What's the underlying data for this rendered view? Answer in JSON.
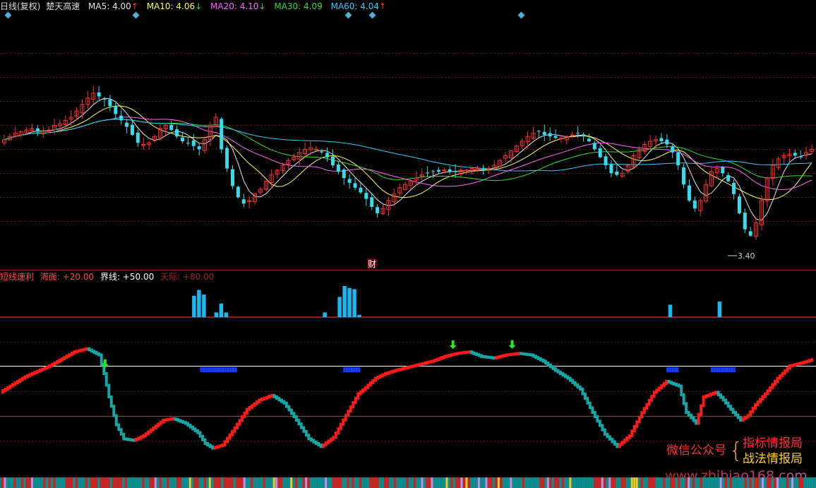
{
  "main_panel": {
    "title": "日线(复权)",
    "indicator_name": "楚天高速",
    "ma_legend": [
      {
        "label": "MA5: 4.00",
        "arrow": "↑",
        "color": "#e8e8e8",
        "arrow_color": "#ff3b3b"
      },
      {
        "label": "MA10: 4.06",
        "arrow": "↓",
        "color": "#ffff55",
        "arrow_color": "#33dd33"
      },
      {
        "label": "MA20: 4.10",
        "arrow": "↓",
        "color": "#ff66ff",
        "arrow_color": "#33dd33"
      },
      {
        "label": "MA30: 4.09",
        "arrow": "",
        "color": "#33dd33",
        "arrow_color": "#33dd33"
      },
      {
        "label": "MA60: 4.04",
        "arrow": "↑",
        "color": "#33ccff",
        "arrow_color": "#ff3b3b"
      }
    ],
    "low_label": "3.40",
    "finance_marker": "财",
    "up_color": "#ff2e2e",
    "down_color": "#33ddee"
  },
  "sub_panel": {
    "legend": [
      {
        "text": "短线速利",
        "color": "#ff4444"
      },
      {
        "text": "海面: +20.00",
        "color": "#ff4444"
      },
      {
        "text": "界线: +50.00",
        "color": "#ffffff"
      },
      {
        "text": "天际: +80.00",
        "color": "#aa2222"
      }
    ],
    "thresholds": {
      "sea": 20,
      "boundary": 50,
      "sky": 80
    }
  },
  "watermark": {
    "label": "微信公众号",
    "line1": "指标情报局",
    "line2": "战法情报局",
    "url": "www.zhibiao168.com"
  },
  "chart_data": [
    {
      "type": "candlestick",
      "title": "楚天高速 日线(复权)",
      "ylim": [
        3.3,
        4.8
      ],
      "price_levels": [
        4.6,
        4.45,
        4.3,
        4.15,
        4.0,
        3.85,
        3.7,
        3.55
      ],
      "series": [
        {
          "name": "MA5",
          "last": 4.0
        },
        {
          "name": "MA10",
          "last": 4.06
        },
        {
          "name": "MA20",
          "last": 4.1
        },
        {
          "name": "MA30",
          "last": 4.09
        },
        {
          "name": "MA60",
          "last": 4.04
        }
      ],
      "closes": [
        4.06,
        4.08,
        4.1,
        4.11,
        4.12,
        4.13,
        4.11,
        4.1,
        4.12,
        4.15,
        4.16,
        4.18,
        4.2,
        4.24,
        4.28,
        4.32,
        4.35,
        4.33,
        4.31,
        4.27,
        4.22,
        4.18,
        4.14,
        4.09,
        4.04,
        4.03,
        4.04,
        4.08,
        4.13,
        4.15,
        4.12,
        4.08,
        4.05,
        4.04,
        4.02,
        4.0,
        4.06,
        4.15,
        4.2,
        4.0,
        3.88,
        3.77,
        3.7,
        3.66,
        3.68,
        3.72,
        3.75,
        3.8,
        3.84,
        3.87,
        3.9,
        3.93,
        3.95,
        3.98,
        4.0,
        4.01,
        4.0,
        3.98,
        3.95,
        3.9,
        3.86,
        3.82,
        3.79,
        3.76,
        3.73,
        3.69,
        3.64,
        3.6,
        3.63,
        3.68,
        3.72,
        3.76,
        3.78,
        3.8,
        3.82,
        3.84,
        3.85,
        3.86,
        3.86,
        3.87,
        3.86,
        3.86,
        3.87,
        3.87,
        3.88,
        3.88,
        3.87,
        3.88,
        3.9,
        3.93,
        3.96,
        3.99,
        4.02,
        4.05,
        4.08,
        4.1,
        4.11,
        4.09,
        4.08,
        4.07,
        4.07,
        4.08,
        4.09,
        4.1,
        4.08,
        4.05,
        4.0,
        3.95,
        3.9,
        3.85,
        3.84,
        3.85,
        3.9,
        3.96,
        4.0,
        4.03,
        4.05,
        4.06,
        4.05,
        4.03,
        3.98,
        3.9,
        3.78,
        3.68,
        3.63,
        3.68,
        3.78,
        3.86,
        3.88,
        3.85,
        3.8,
        3.72,
        3.6,
        3.5,
        3.46,
        3.54,
        3.68,
        3.82,
        3.9,
        3.94,
        3.96,
        3.97,
        3.96,
        3.95,
        3.98,
        4.0
      ]
    },
    {
      "type": "bar",
      "title": "短线速利",
      "ylim": [
        0,
        100
      ],
      "bars": [
        {
          "x": 78,
          "value": 55
        },
        {
          "x": 80,
          "value": 70
        },
        {
          "x": 82,
          "value": 58
        },
        {
          "x": 87,
          "value": 12
        },
        {
          "x": 89,
          "value": 35
        },
        {
          "x": 91,
          "value": 12
        },
        {
          "x": 131,
          "value": 12
        },
        {
          "x": 137,
          "value": 52
        },
        {
          "x": 139,
          "value": 80
        },
        {
          "x": 141,
          "value": 75
        },
        {
          "x": 143,
          "value": 72
        },
        {
          "x": 145,
          "value": 6
        },
        {
          "x": 271,
          "value": 32
        },
        {
          "x": 291,
          "value": 40
        }
      ]
    },
    {
      "type": "line",
      "title": "短线速利 曲线",
      "ylim": [
        0,
        100
      ],
      "reference_lines": [
        80,
        50,
        20
      ],
      "x": [
        0,
        10,
        20,
        30,
        35,
        40,
        42,
        44,
        47,
        50,
        54,
        58,
        62,
        66,
        70,
        75,
        80,
        83,
        86,
        90,
        95,
        100,
        105,
        110,
        115,
        120,
        125,
        130,
        135,
        140,
        145,
        148,
        152,
        156,
        160,
        165,
        170,
        175,
        180,
        185,
        190,
        195,
        200,
        205,
        210,
        215,
        220,
        225,
        230,
        235,
        240,
        245,
        250,
        255,
        260,
        265,
        270,
        275,
        278,
        282,
        285,
        290,
        293,
        297,
        300,
        303,
        306,
        310,
        315,
        320,
        325,
        329
      ],
      "y": [
        33,
        43,
        50,
        59,
        61,
        57,
        45,
        30,
        12,
        3,
        2,
        5,
        10,
        15,
        16,
        13,
        7,
        0,
        -3,
        -1,
        10,
        22,
        28,
        31,
        26,
        15,
        3,
        -2,
        4,
        18,
        32,
        36,
        42,
        45,
        47,
        49,
        51,
        53,
        56,
        58,
        59,
        56,
        55,
        57,
        58,
        57,
        53,
        47,
        42,
        35,
        20,
        6,
        -2,
        5,
        20,
        33,
        40,
        37,
        20,
        13,
        30,
        33,
        28,
        20,
        15,
        18,
        25,
        32,
        42,
        50,
        52,
        54
      ],
      "arrow_markers_at_x": [
        42,
        183,
        207
      ],
      "blue_marks": [
        [
          81,
          95
        ],
        [
          139,
          145
        ],
        [
          270,
          274
        ],
        [
          288,
          297
        ]
      ]
    }
  ]
}
